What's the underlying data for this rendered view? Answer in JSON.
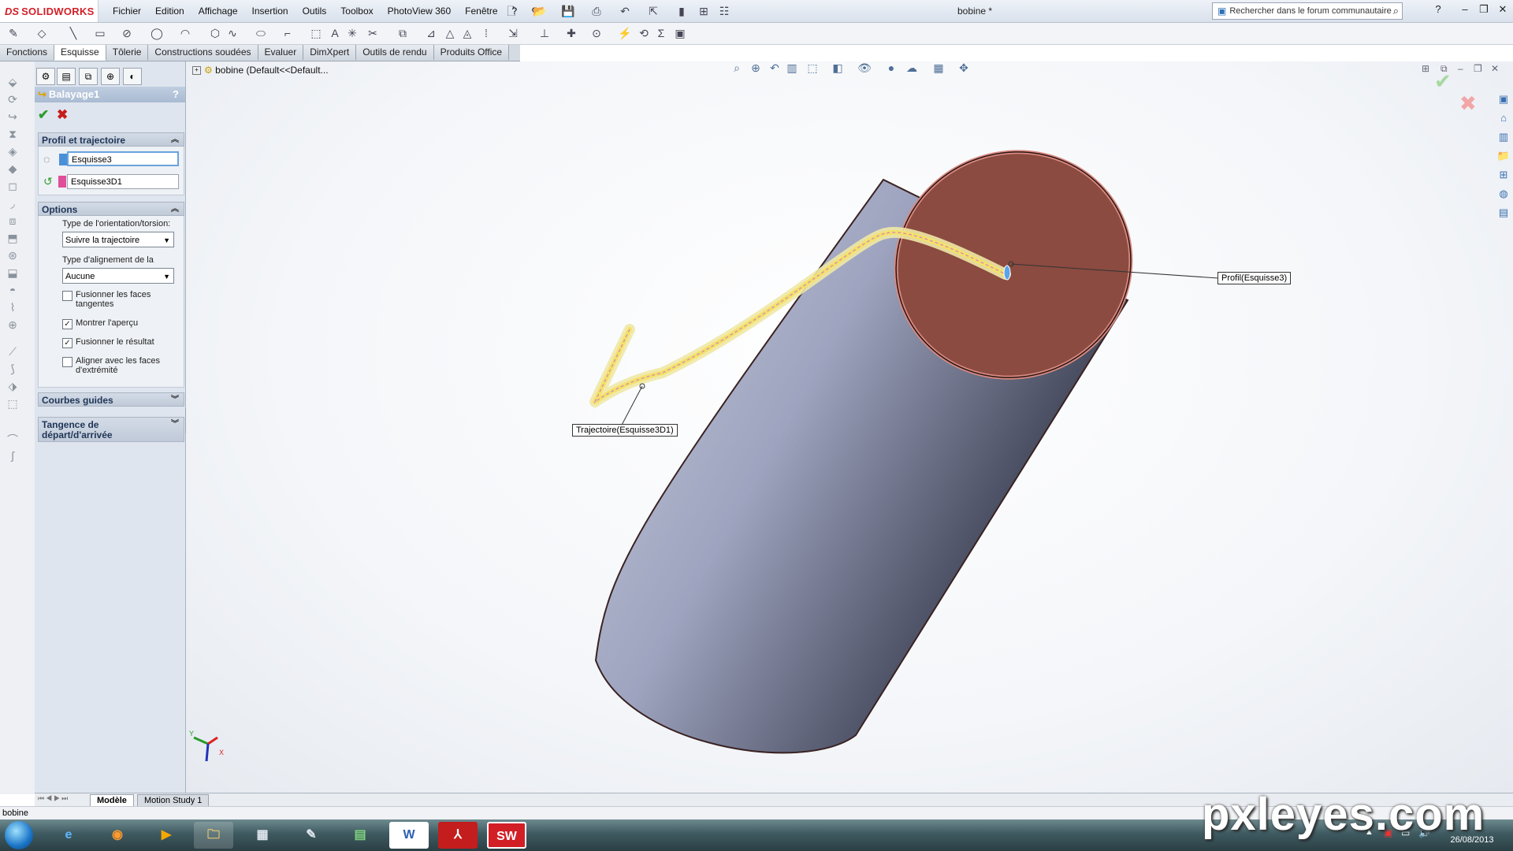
{
  "app": {
    "brand_prefix": "DS",
    "brand_name": "SOLIDWORKS",
    "document_title": "bobine *"
  },
  "menu": [
    "Fichier",
    "Edition",
    "Affichage",
    "Insertion",
    "Outils",
    "Toolbox",
    "PhotoView 360",
    "Fenêtre",
    "?"
  ],
  "search": {
    "placeholder": "Rechercher dans le forum communautaire"
  },
  "command_tabs": [
    {
      "label": "Fonctions",
      "active": false
    },
    {
      "label": "Esquisse",
      "active": true
    },
    {
      "label": "Tôlerie",
      "active": false
    },
    {
      "label": "Constructions soudées",
      "active": false
    },
    {
      "label": "Evaluer",
      "active": false
    },
    {
      "label": "DimXpert",
      "active": false
    },
    {
      "label": "Outils de rendu",
      "active": false
    },
    {
      "label": "Produits Office",
      "active": false
    }
  ],
  "property_manager": {
    "title": "Balayage1",
    "help": "?",
    "ok": "✔",
    "cancel": "✖",
    "profile_group": {
      "title": "Profil et trajectoire",
      "profile_value": "Esquisse3",
      "path_value": "Esquisse3D1",
      "profile_color": "#4a90d9",
      "path_color": "#e04f9a"
    },
    "options_group": {
      "title": "Options",
      "orientation_label": "Type de l'orientation/torsion:",
      "orientation_value": "Suivre la trajectoire",
      "alignment_label": "Type d'alignement de la",
      "alignment_value": "Aucune",
      "checkboxes": [
        {
          "label": "Fusionner les faces tangentes",
          "checked": false
        },
        {
          "label": "Montrer l'aperçu",
          "checked": true
        },
        {
          "label": "Fusionner le résultat",
          "checked": true
        },
        {
          "label": "Aligner avec les faces d'extrémité",
          "checked": false
        }
      ]
    },
    "guide_group": {
      "title": "Courbes guides"
    },
    "tangency_group": {
      "title": "Tangence de départ/d'arrivée"
    }
  },
  "feature_tree": {
    "root": "bobine  (Default<<Default..."
  },
  "callouts": {
    "profile": "Profil(Esquisse3)",
    "path": "Trajectoire(Esquisse3D1)"
  },
  "bottom_tabs": [
    {
      "label": "Modèle",
      "active": true
    },
    {
      "label": "Motion Study 1",
      "active": false
    }
  ],
  "status": {
    "left": "bobine"
  },
  "taskbar": {
    "date": "26/08/2013"
  },
  "watermark": "pxleyes.com",
  "colors": {
    "cylinder_body": "#9ea4bf",
    "cylinder_top": "#8b4b40",
    "sweep_path": "#f2e36a",
    "brand_red": "#d21f26"
  }
}
